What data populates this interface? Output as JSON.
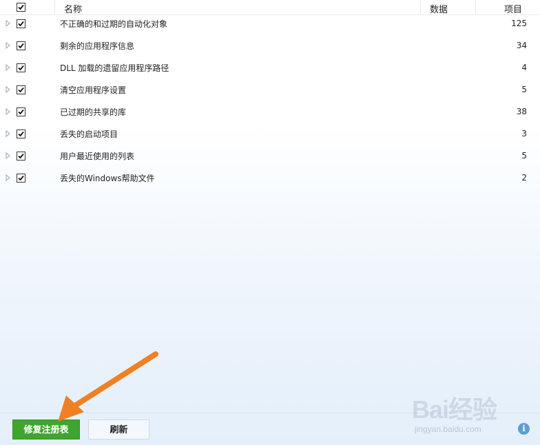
{
  "header": {
    "name_label": "名称",
    "data_label": "数据",
    "items_label": "项目"
  },
  "rows": [
    {
      "name": "不正确的和过期的自动化对象",
      "count": "125"
    },
    {
      "name": "剩余的应用程序信息",
      "count": "34"
    },
    {
      "name": "DLL 加载的遗留应用程序路径",
      "count": "4"
    },
    {
      "name": "清空应用程序设置",
      "count": "5"
    },
    {
      "name": "已过期的共享的库",
      "count": "38"
    },
    {
      "name": "丢失的启动项目",
      "count": "3"
    },
    {
      "name": "用户最近使用的列表",
      "count": "5"
    },
    {
      "name": "丢失的Windows帮助文件",
      "count": "2"
    }
  ],
  "footer": {
    "fix_label": "修复注册表",
    "refresh_label": "刷新",
    "info_glyph": "i"
  },
  "watermark": {
    "logo": "Bai经验",
    "site": "jingyan.baidu.com"
  },
  "colors": {
    "fix_button": "#3fa52f",
    "arrow": "#f08024",
    "info": "#5a9fd6"
  }
}
